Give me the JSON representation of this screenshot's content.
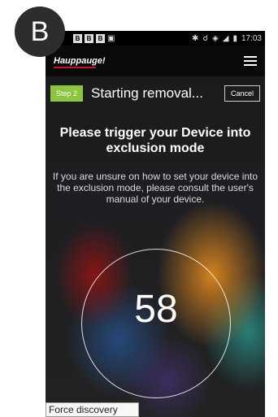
{
  "badge": {
    "label": "B"
  },
  "statusbar": {
    "time": "17:03",
    "notif_icons": [
      "B",
      "B",
      "B"
    ]
  },
  "appbar": {
    "logo": "Hauppauge!",
    "menu_icon": "hamburger-menu-icon"
  },
  "stepbar": {
    "step_label": "Step 2",
    "title": "Starting removal...",
    "cancel_label": "Cancel"
  },
  "main": {
    "heading": "Please trigger your Device into exclusion mode",
    "info": "If you are unsure on how to set your device into the exclusion mode, please consult the user's manual of your device.",
    "countdown": "58",
    "force_label": "Force discovery"
  },
  "colors": {
    "accent_green": "#8cc63f",
    "brand_red": "#c8102e"
  }
}
